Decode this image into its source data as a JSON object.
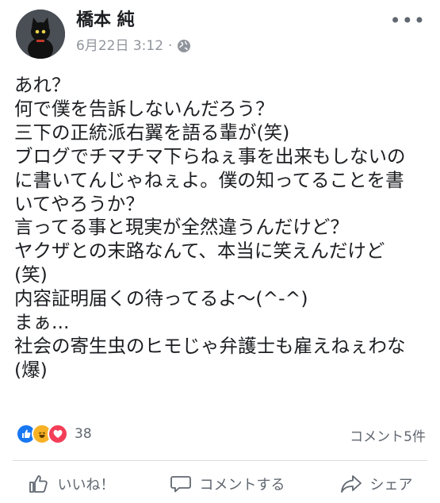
{
  "post": {
    "author": "橋本 純",
    "date": "6月22日 3:12",
    "dot": "·",
    "lines": [
      "あれ？",
      "何で僕を告訴しないんだろう？",
      "三下の正統派右翼を語る輩が(笑)",
      "ブログでチマチマ下らねぇ事を出来もしないの",
      "に書いてんじゃねぇよ。僕の知ってることを書",
      "いてやろうか？",
      "言ってる事と現実が全然違うんだけど？",
      "ヤクザとの末路なんて、本当に笑えんだけど",
      "(笑)",
      "内容証明届くの待ってるよ〜(^-^)",
      "まぁ...",
      "社会の寄生虫のヒモじゃ弁護士も雇えねぇわな",
      "(爆)"
    ]
  },
  "stats": {
    "reaction_count": "38",
    "comments": "コメント5件"
  },
  "actions": {
    "like": "いいね！",
    "comment": "コメントする",
    "share": "シェア"
  },
  "colors": {
    "like": "#1877f2",
    "haha": "#f7b125",
    "love": "#f33e58",
    "muted": "#606770"
  }
}
